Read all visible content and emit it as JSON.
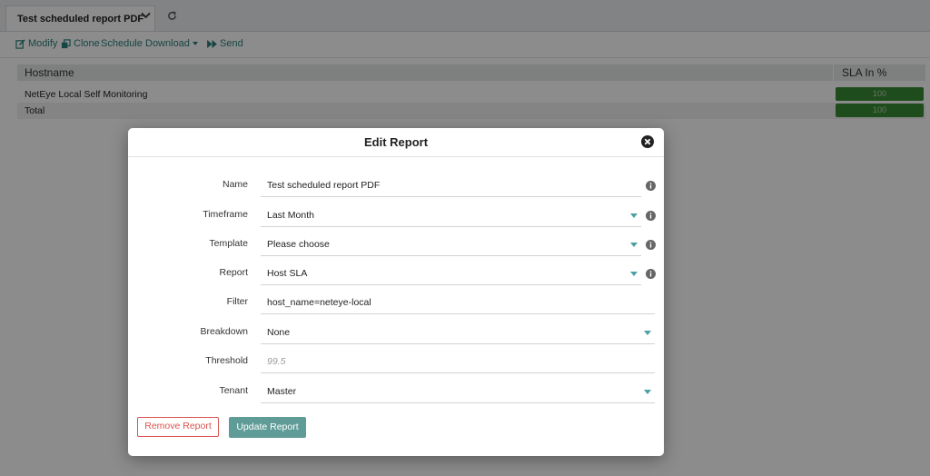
{
  "tabs": {
    "active_label": "Test scheduled report PDF",
    "dropdown_icon": "chevron-down-icon",
    "refresh_icon": "refresh-icon"
  },
  "actions": {
    "modify": "Modify",
    "clone": "Clone",
    "schedule": "Schedule",
    "download": "Download",
    "send": "Send"
  },
  "table": {
    "headers": [
      "Hostname",
      "SLA In %"
    ],
    "rows": [
      {
        "host": "NetEye Local Self Monitoring",
        "sla": "100"
      },
      {
        "host": "Total",
        "sla": "100"
      }
    ]
  },
  "modal": {
    "title": "Edit Report",
    "fields": {
      "name": {
        "label": "Name",
        "value": "Test scheduled report PDF"
      },
      "timeframe": {
        "label": "Timeframe",
        "value": "Last Month"
      },
      "template": {
        "label": "Template",
        "value": "Please choose"
      },
      "report": {
        "label": "Report",
        "value": "Host SLA"
      },
      "filter": {
        "label": "Filter",
        "value": "host_name=neteye-local"
      },
      "breakdown": {
        "label": "Breakdown",
        "value": "None"
      },
      "threshold": {
        "label": "Threshold",
        "placeholder": "99.5"
      },
      "tenant": {
        "label": "Tenant",
        "value": "Master"
      }
    },
    "remove_label": "Remove Report",
    "update_label": "Update Report"
  },
  "colors": {
    "accent": "#2a7f7c",
    "sla_ok": "#3a8a35",
    "danger": "#d9534f",
    "primary_button": "#5f9c98"
  }
}
